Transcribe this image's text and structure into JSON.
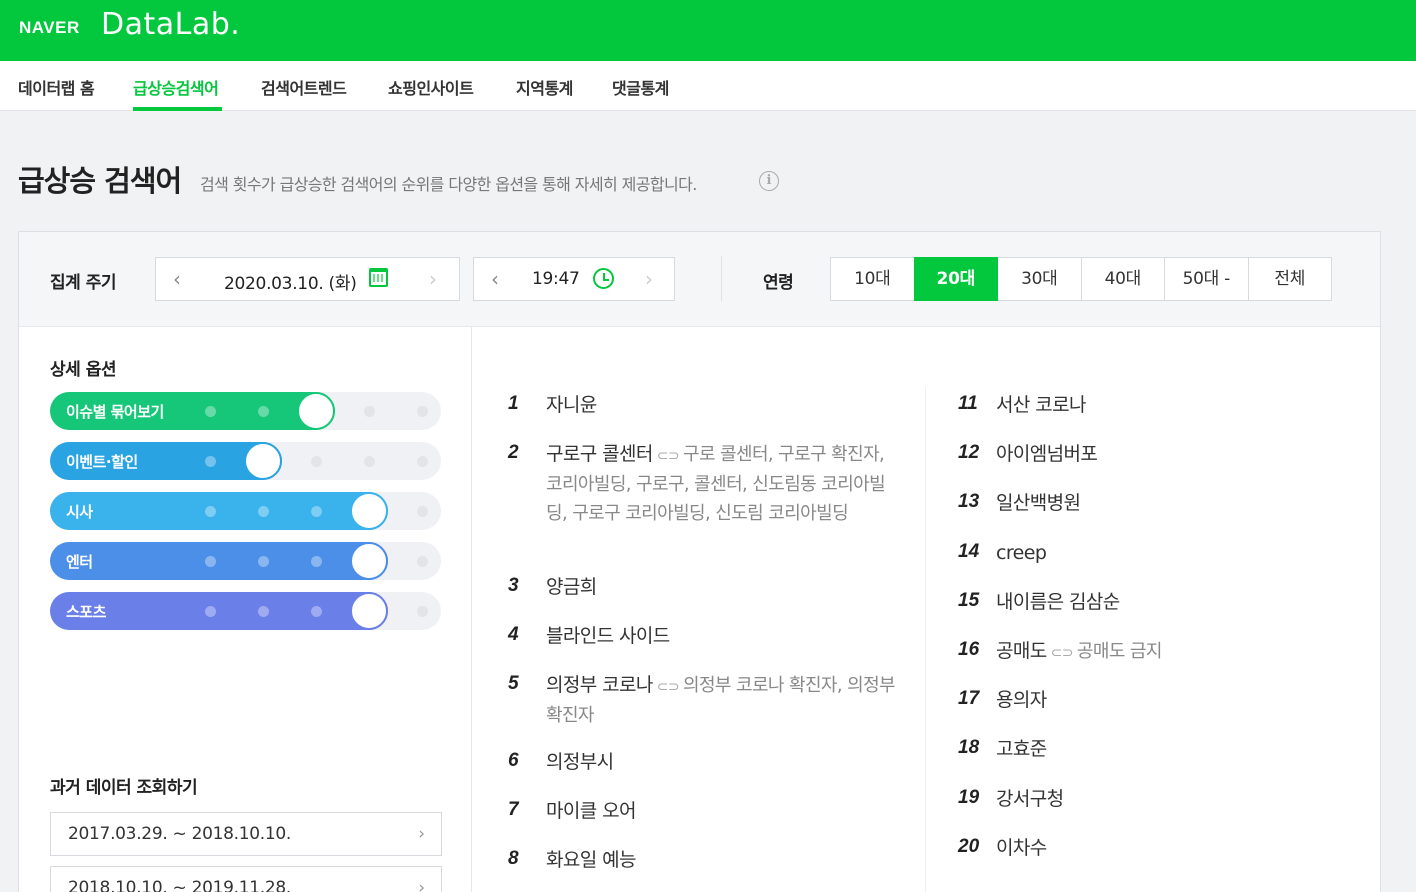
{
  "brand": {
    "naver": "NAVER",
    "datalab": "DataLab."
  },
  "nav": {
    "items": [
      "데이터랩 홈",
      "급상승검색어",
      "검색어트렌드",
      "쇼핑인사이트",
      "지역통계",
      "댓글통계"
    ],
    "active_index": 1
  },
  "page": {
    "title": "급상승 검색어",
    "description": "검색 횟수가 급상승한 검색어의 순위를 다양한 옵션을 통해 자세히 제공합니다.",
    "info_icon": "i"
  },
  "filters": {
    "period_label": "집계 주기",
    "date": "2020.03.10. (화)",
    "time": "19:47",
    "age_label": "연령",
    "ages": [
      "10대",
      "20대",
      "30대",
      "40대",
      "50대 -",
      "전체"
    ],
    "age_active_index": 1,
    "prev_arrow": "‹",
    "next_arrow": "›"
  },
  "options": {
    "title": "상세 옵션",
    "toggles": [
      {
        "label": "이슈별 묶어보기",
        "level": 2,
        "color": "#16c77a"
      },
      {
        "label": "이벤트·할인",
        "level": 1,
        "color": "#2aa3e3"
      },
      {
        "label": "시사",
        "level": 3,
        "color": "#3ab2ec"
      },
      {
        "label": "엔터",
        "level": 3,
        "color": "#4c8fe8"
      },
      {
        "label": "스포츠",
        "level": 3,
        "color": "#6a7fe8"
      }
    ]
  },
  "past": {
    "title": "과거 데이터 조회하기",
    "ranges": [
      "2017.03.29. ~ 2018.10.10.",
      "2018.10.10. ~ 2019.11.28."
    ],
    "arrow": "›"
  },
  "ranking": {
    "link_icon": "⊂⊃",
    "left": [
      {
        "rank": "1",
        "keyword": "자니윤",
        "related": ""
      },
      {
        "rank": "2",
        "keyword": "구로구 콜센터",
        "related": "구로 콜센터, 구로구 확진자, 코리아빌딩, 구로구, 콜센터, 신도림동 코리아빌딩, 구로구 코리아빌딩, 신도림 코리아빌딩"
      },
      {
        "rank": "3",
        "keyword": "양금희",
        "related": ""
      },
      {
        "rank": "4",
        "keyword": "블라인드 사이드",
        "related": ""
      },
      {
        "rank": "5",
        "keyword": "의정부 코로나",
        "related": "의정부 코로나 확진자, 의정부 확진자"
      },
      {
        "rank": "6",
        "keyword": "의정부시",
        "related": ""
      },
      {
        "rank": "7",
        "keyword": "마이클 오어",
        "related": ""
      },
      {
        "rank": "8",
        "keyword": "화요일 예능",
        "related": ""
      }
    ],
    "right": [
      {
        "rank": "11",
        "keyword": "서산 코로나",
        "related": ""
      },
      {
        "rank": "12",
        "keyword": "아이엠넘버포",
        "related": ""
      },
      {
        "rank": "13",
        "keyword": "일산백병원",
        "related": ""
      },
      {
        "rank": "14",
        "keyword": "creep",
        "related": ""
      },
      {
        "rank": "15",
        "keyword": "내이름은 김삼순",
        "related": ""
      },
      {
        "rank": "16",
        "keyword": "공매도",
        "related": "공매도 금지"
      },
      {
        "rank": "17",
        "keyword": "용의자",
        "related": ""
      },
      {
        "rank": "18",
        "keyword": "고효준",
        "related": ""
      },
      {
        "rank": "19",
        "keyword": "강서구청",
        "related": ""
      },
      {
        "rank": "20",
        "keyword": "이차수",
        "related": ""
      }
    ]
  }
}
